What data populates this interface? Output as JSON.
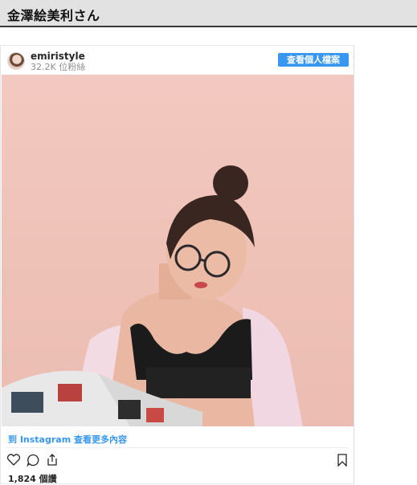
{
  "page": {
    "title": "金澤絵美利さん"
  },
  "embed": {
    "username": "emiristyle",
    "followers": "32.2K 位粉絲",
    "view_profile_label": "查看個人檔案",
    "view_more_label": "到 Instagram 查看更多內容",
    "likes": "1,824 個讚",
    "icons": [
      "heart-icon",
      "comment-icon",
      "share-icon",
      "bookmark-icon"
    ],
    "colors": {
      "accent": "#3897f0",
      "header_bg": "#e2e2e2",
      "photo_bg": "#f0c4ba"
    }
  }
}
